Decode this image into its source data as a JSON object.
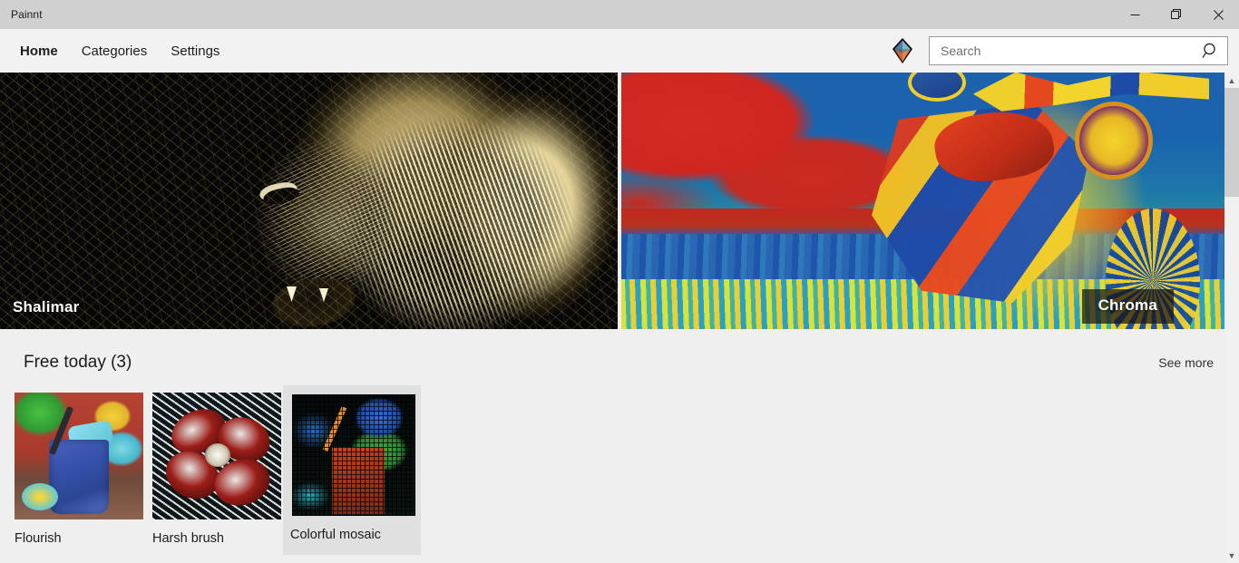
{
  "window": {
    "title": "Painnt",
    "controls": [
      {
        "name": "minimize",
        "glyph": "—"
      },
      {
        "name": "restore",
        "glyph": "❐"
      },
      {
        "name": "close",
        "glyph": "✕"
      }
    ]
  },
  "nav": {
    "items": [
      {
        "label": "Home",
        "active": true
      },
      {
        "label": "Categories",
        "active": false
      },
      {
        "label": "Settings",
        "active": false
      }
    ],
    "logo_name": "painnt-gem-logo",
    "search": {
      "placeholder": "Search",
      "value": "",
      "icon": "search-icon"
    }
  },
  "hero": {
    "left": {
      "label": "Shalimar",
      "artwork": "lion-etching"
    },
    "right": {
      "label": "Chroma",
      "artwork": "motorcycle-false-color",
      "hovered": true
    }
  },
  "section": {
    "title": "Free today (3)",
    "see_more": "See more",
    "cards": [
      {
        "label": "Flourish",
        "artwork": "drink-painterly",
        "hovered": false
      },
      {
        "label": "Harsh brush",
        "artwork": "flower-brush",
        "hovered": false
      },
      {
        "label": "Colorful mosaic",
        "artwork": "drink-mosaic",
        "hovered": true
      }
    ]
  },
  "scrollbar": {
    "up_glyph": "▲",
    "down_glyph": "▼"
  },
  "colors": {
    "titlebar": "#d0d0d0",
    "navbar": "#f2f2f2",
    "page_bg": "#efeff0",
    "hover_card": "#e0e0e0",
    "text": "#1b1b1b",
    "close_hover": "#e81123"
  }
}
